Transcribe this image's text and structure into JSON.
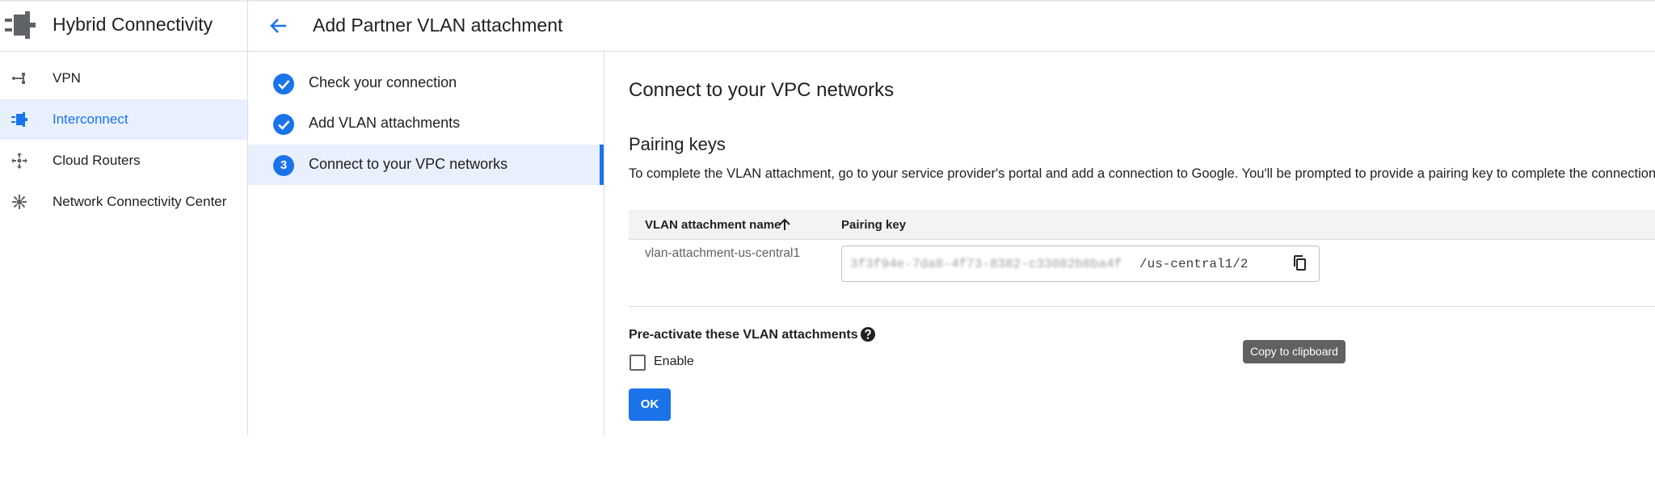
{
  "product": {
    "title": "Hybrid Connectivity",
    "icon": "interconnect-product-icon"
  },
  "sidebar": {
    "items": [
      {
        "label": "VPN",
        "icon": "vpn-icon",
        "active": false
      },
      {
        "label": "Interconnect",
        "icon": "interconnect-icon",
        "active": true
      },
      {
        "label": "Cloud Routers",
        "icon": "cloud-router-icon",
        "active": false
      },
      {
        "label": "Network Connectivity Center",
        "icon": "network-hub-icon",
        "active": false
      }
    ]
  },
  "header": {
    "back_icon": "arrow-back-icon",
    "title": "Add Partner VLAN attachment"
  },
  "stepper": {
    "steps": [
      {
        "label": "Check your connection",
        "status": "complete"
      },
      {
        "label": "Add VLAN attachments",
        "status": "complete"
      },
      {
        "number": "3",
        "label": "Connect to your VPC networks",
        "status": "active"
      }
    ]
  },
  "main": {
    "title": "Connect to your VPC networks",
    "pairing": {
      "title": "Pairing keys",
      "description": "To complete the VLAN attachment, go to your service provider's portal and add a connection to Google. You'll be prompted to provide a pairing key to complete the connection."
    },
    "table": {
      "columns": [
        "VLAN attachment name",
        "Pairing key"
      ],
      "sort_icon": "arrow-upward-icon",
      "rows": [
        {
          "name": "vlan-attachment-us-central1",
          "key_masked": "3f3f94e-7da8-4f73-8382-c33082b8ba4f",
          "key_suffix": "/us-central1/2"
        }
      ]
    },
    "copy_tooltip": "Copy to clipboard",
    "preactivate": {
      "label": "Pre-activate these VLAN attachments",
      "help_icon": "help-icon",
      "checkbox_label": "Enable",
      "checked": false
    },
    "ok_label": "OK"
  },
  "colors": {
    "accent": "#1a73e8",
    "active_bg": "#e8f0fe",
    "border": "#dadce0",
    "header_bg": "#f1f3f4"
  }
}
